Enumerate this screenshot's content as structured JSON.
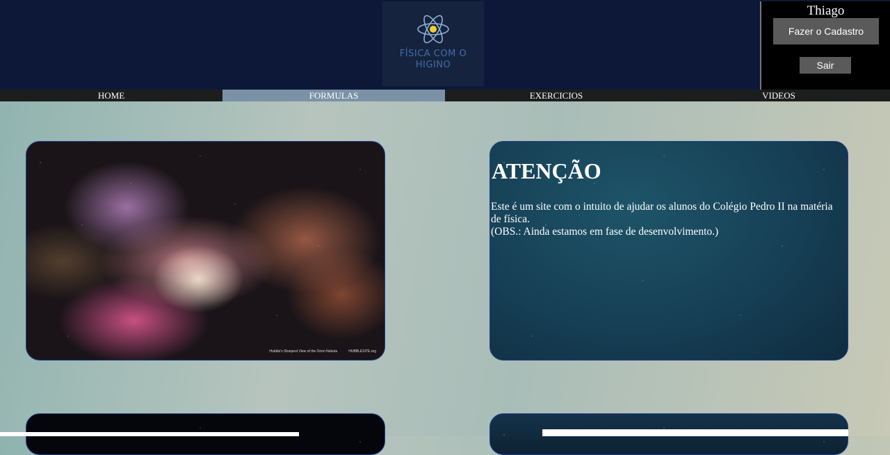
{
  "logo": {
    "line1": "FÍSICA COM O",
    "line2": "HIGINO",
    "icon": "atom-icon"
  },
  "user": {
    "name": "Thiago",
    "register_label": "Fazer o Cadastro",
    "exit_label": "Sair"
  },
  "nav": {
    "items": [
      {
        "label": "HOME"
      },
      {
        "label": "FORMULAS"
      },
      {
        "label": "EXERCICIOS"
      },
      {
        "label": "VIDEOS"
      }
    ],
    "active": "FORMULAS"
  },
  "cards": {
    "nebula": {
      "caption": "Hubble's Sharpest View of the Orion Nebula",
      "brand": "HUBBLESITE.org"
    },
    "info": {
      "title": "ATENÇÃO",
      "line1": "Este é um site com o intuito de ajudar os alunos do Colégio Pedro II na matéria de física.",
      "line2": "(OBS.: Ainda estamos em fase de desenvolvimento.)"
    }
  },
  "colors": {
    "header_bg": "#0d1838",
    "nav_bg": "#1c1e1e",
    "nav_active": "#7b92a6",
    "card_border": "#1f3f8f",
    "button_bg": "#5a5a5a"
  }
}
